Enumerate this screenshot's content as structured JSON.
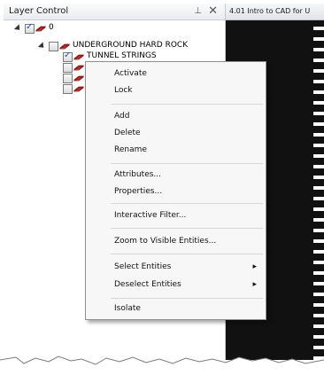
{
  "panel": {
    "title": "Layer Control",
    "pin_glyph": "⊥",
    "close_glyph": "✕"
  },
  "tree": {
    "root": {
      "label": "0",
      "checked": true
    },
    "child": {
      "label": "UNDERGROUND HARD ROCK",
      "checked": false
    },
    "grandchild": {
      "label": "TUNNEL STRINGS",
      "checked": true
    }
  },
  "document_tab": {
    "label": "4.01 Intro to CAD for U"
  },
  "context_menu": {
    "items": [
      "Activate",
      "Lock",
      "Add",
      "Delete",
      "Rename",
      "Attributes...",
      "Properties...",
      "Interactive Filter...",
      "Zoom to Visible Entities...",
      "Select Entities",
      "Deselect Entities",
      "Isolate"
    ],
    "submenu_glyph": "▸"
  },
  "icons": [
    "pin-icon",
    "close-icon",
    "expand-arrow-icon",
    "checkbox-icon",
    "layer-icon",
    "submenu-arrow-icon"
  ],
  "colors": {
    "panel_background": "#ffffff",
    "viewport_background": "#111111",
    "menu_background": "#f7f7f7",
    "layer_icon_red": "#d9322a",
    "checkbox_check": "#1d4fb8"
  }
}
